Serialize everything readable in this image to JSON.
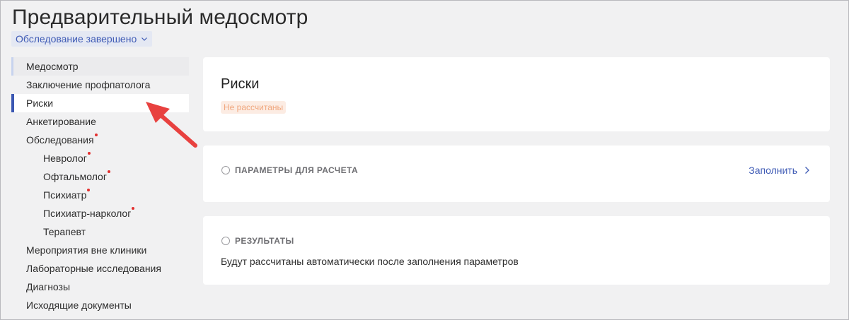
{
  "page": {
    "title": "Предварительный медосмотр",
    "status": "Обследование завершено"
  },
  "sidebar": {
    "items": [
      {
        "label": "Медосмотр"
      },
      {
        "label": "Заключение профпатолога"
      },
      {
        "label": "Риски"
      },
      {
        "label": "Анкетирование"
      },
      {
        "label": "Обследования"
      },
      {
        "label": "Невролог"
      },
      {
        "label": "Офтальмолог"
      },
      {
        "label": "Психиатр"
      },
      {
        "label": "Психиатр-нарколог"
      },
      {
        "label": "Терапевт"
      },
      {
        "label": "Мероприятия вне клиники"
      },
      {
        "label": "Лабораторные исследования"
      },
      {
        "label": "Диагнозы"
      },
      {
        "label": "Исходящие документы"
      }
    ]
  },
  "risks": {
    "title": "Риски",
    "badge": "Не рассчитаны"
  },
  "params": {
    "heading": "ПАРАМЕТРЫ ДЛЯ РАСЧЕТА",
    "fill_label": "Заполнить"
  },
  "results": {
    "heading": "РЕЗУЛЬТАТЫ",
    "text": "Будут рассчитаны автоматически после заполнения параметров"
  },
  "colors": {
    "accent": "#3b57b2",
    "badge_text": "#f0a77e",
    "badge_bg": "#fcece3",
    "alert_dot": "#e3302f",
    "annotation_arrow": "#e8413f"
  }
}
